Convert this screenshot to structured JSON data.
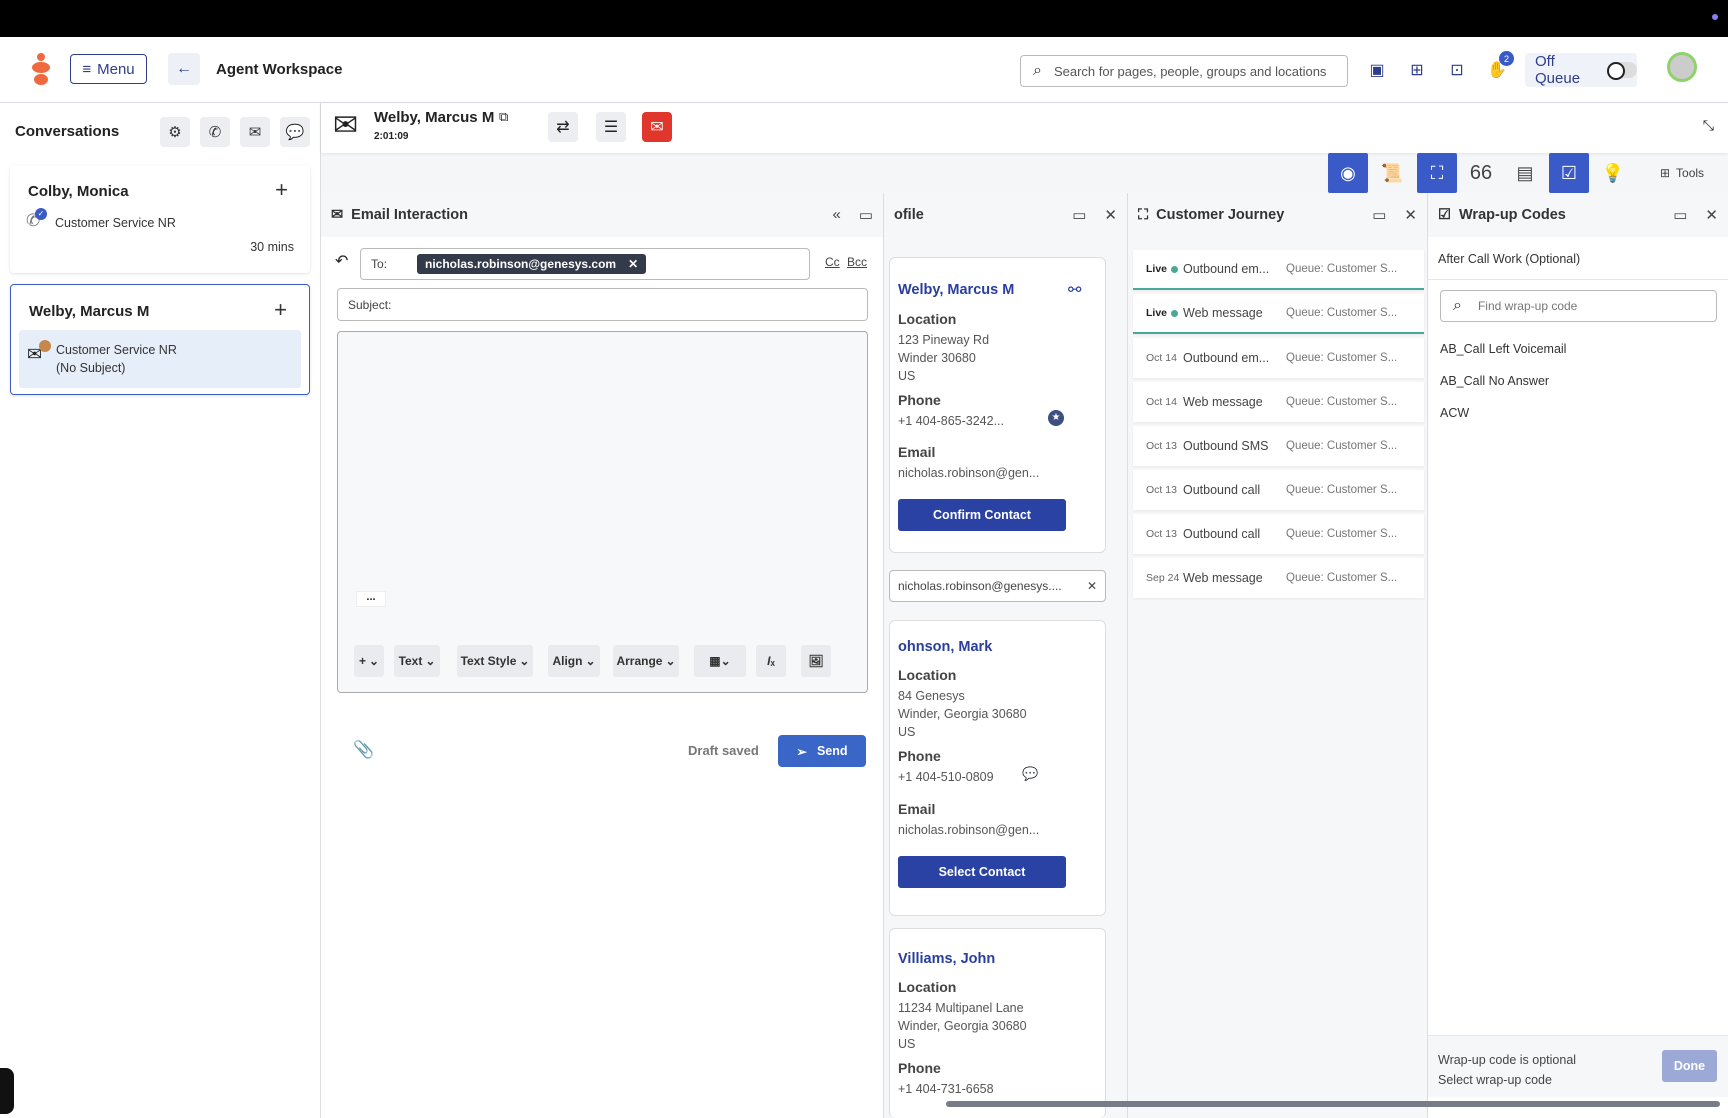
{
  "header": {
    "menu_label": "Menu",
    "title": "Agent Workspace",
    "search_placeholder": "Search for pages, people, groups and locations",
    "notification_count": "2",
    "queue_status": "Off Queue"
  },
  "conversations": {
    "title": "Conversations",
    "items": [
      {
        "name": "Colby, Monica",
        "queue": "Customer Service NR",
        "time": "30 mins"
      },
      {
        "name": "Welby, Marcus M",
        "queue": "Customer Service NR",
        "subject": "(No Subject)"
      }
    ]
  },
  "interaction": {
    "name": "Welby, Marcus M",
    "timer": "2:01:09"
  },
  "tools": {
    "quote_label": "66",
    "tools_label": "Tools"
  },
  "email": {
    "title": "Email Interaction",
    "to_label": "To:",
    "recipient": "nicholas.robinson@genesys.com",
    "cc": "Cc",
    "bcc": "Bcc",
    "subject_label": "Subject:",
    "more": "...",
    "toolbar": [
      "+",
      "Text",
      "Text Style",
      "Align",
      "Arrange"
    ],
    "draft_status": "Draft saved",
    "send_label": "Send"
  },
  "profile": {
    "title": "ofile",
    "search_value": "nicholas.robinson@genesys....",
    "confirm_label": "Confirm Contact",
    "select_label": "Select Contact",
    "labels": {
      "location": "Location",
      "phone": "Phone",
      "email": "Email"
    },
    "contacts": [
      {
        "name": "Welby, Marcus M",
        "address": [
          "123 Pineway Rd",
          "Winder 30680",
          "US"
        ],
        "phone": "+1 404-865-3242...",
        "email": "nicholas.robinson@gen..."
      },
      {
        "name": "ohnson, Mark",
        "address": [
          "84 Genesys",
          "Winder, Georgia 30680",
          "US"
        ],
        "phone": "+1 404-510-0809",
        "email": "nicholas.robinson@gen..."
      },
      {
        "name": "Villiams, John",
        "address": [
          "11234 Multipanel Lane",
          "Winder, Georgia 30680",
          "US"
        ],
        "phone": "+1 404-731-6658"
      }
    ]
  },
  "journey": {
    "title": "Customer Journey",
    "rows": [
      {
        "date": "Live",
        "type": "Outbound em...",
        "queue": "Queue: Customer S...",
        "live": true
      },
      {
        "date": "Live",
        "type": "Web message",
        "queue": "Queue: Customer S...",
        "live": true
      },
      {
        "date": "Oct 14",
        "type": "Outbound em...",
        "queue": "Queue: Customer S..."
      },
      {
        "date": "Oct 14",
        "type": "Web message",
        "queue": "Queue: Customer S..."
      },
      {
        "date": "Oct 13",
        "type": "Outbound SMS",
        "queue": "Queue: Customer S..."
      },
      {
        "date": "Oct 13",
        "type": "Outbound call",
        "queue": "Queue: Customer S..."
      },
      {
        "date": "Oct 13",
        "type": "Outbound call",
        "queue": "Queue: Customer S..."
      },
      {
        "date": "Sep 24",
        "type": "Web message",
        "queue": "Queue: Customer S..."
      }
    ]
  },
  "wrapup": {
    "title": "Wrap-up Codes",
    "subtitle": "After Call Work (Optional)",
    "search_placeholder": "Find wrap-up code",
    "codes": [
      "AB_Call Left Voicemail",
      "AB_Call No Answer",
      "ACW"
    ],
    "footer_line1": "Wrap-up code is optional",
    "footer_line2": "Select wrap-up code",
    "done_label": "Done"
  },
  "colors": {
    "accent": "#3a5bc7",
    "brand": "#f0683d",
    "danger": "#e0362c",
    "live": "#4aa89a"
  }
}
